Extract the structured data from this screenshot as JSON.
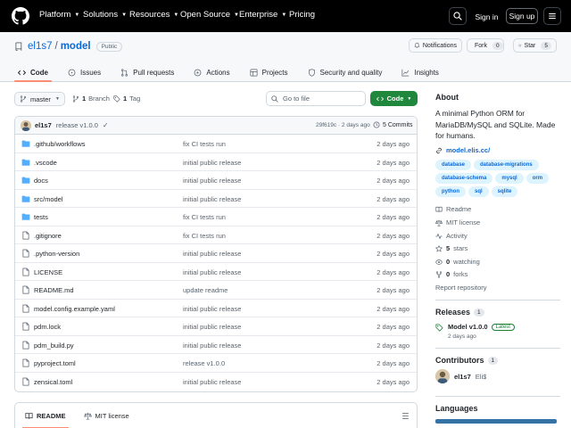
{
  "topbar": {
    "nav": [
      "Platform",
      "Solutions",
      "Resources",
      "Open Source",
      "Enterprise",
      "Pricing"
    ],
    "signin": "Sign in",
    "signup": "Sign up"
  },
  "repo": {
    "owner": "el1s7",
    "separator": "/",
    "name": "model",
    "visibility": "Public",
    "notifications_label": "Notifications",
    "fork_label": "Fork",
    "fork_count": "0",
    "star_label": "Star",
    "star_count": "5"
  },
  "tabs": [
    "Code",
    "Issues",
    "Pull requests",
    "Actions",
    "Projects",
    "Security and quality",
    "Insights"
  ],
  "branchbar": {
    "branch": "master",
    "branch_count": "1",
    "branch_label": "Branch",
    "tag_count": "1",
    "tag_label": "Tag",
    "goto_placeholder": "Go to file",
    "code_label": "Code"
  },
  "commit": {
    "author": "el1s7",
    "message": "release v1.0.0",
    "check": "✓",
    "hash_time": "29f619c · 2 days ago",
    "commits_label": "5 Commits"
  },
  "files": [
    {
      "type": "folder",
      "name": ".github/workflows",
      "message": "fix CI tests run",
      "date": "2 days ago"
    },
    {
      "type": "folder",
      "name": ".vscode",
      "message": "initial public release",
      "date": "2 days ago"
    },
    {
      "type": "folder",
      "name": "docs",
      "message": "initial public release",
      "date": "2 days ago"
    },
    {
      "type": "folder",
      "name": "src/model",
      "message": "initial public release",
      "date": "2 days ago"
    },
    {
      "type": "folder",
      "name": "tests",
      "message": "fix CI tests run",
      "date": "2 days ago"
    },
    {
      "type": "file",
      "name": ".gitignore",
      "message": "fix CI tests run",
      "date": "2 days ago"
    },
    {
      "type": "file",
      "name": ".python-version",
      "message": "initial public release",
      "date": "2 days ago"
    },
    {
      "type": "file",
      "name": "LICENSE",
      "message": "initial public release",
      "date": "2 days ago"
    },
    {
      "type": "file",
      "name": "README.md",
      "message": "update readme",
      "date": "2 days ago"
    },
    {
      "type": "file",
      "name": "model.config.example.yaml",
      "message": "initial public release",
      "date": "2 days ago"
    },
    {
      "type": "file",
      "name": "pdm.lock",
      "message": "initial public release",
      "date": "2 days ago"
    },
    {
      "type": "file",
      "name": "pdm_build.py",
      "message": "initial public release",
      "date": "2 days ago"
    },
    {
      "type": "file",
      "name": "pyproject.toml",
      "message": "release v1.0.0",
      "date": "2 days ago"
    },
    {
      "type": "file",
      "name": "zensical.toml",
      "message": "initial public release",
      "date": "2 days ago"
    }
  ],
  "readme_tabs": [
    "README",
    "MIT license"
  ],
  "about": {
    "heading": "About",
    "description": "A minimal Python ORM for MariaDB/MySQL and SQLite. Made for humans.",
    "link": "model.elis.cc/",
    "topics": [
      "database",
      "database-migrations",
      "database-schema",
      "mysql",
      "orm",
      "python",
      "sql",
      "sqlite"
    ],
    "readme": "Readme",
    "license": "MIT license",
    "activity": "Activity",
    "stars_count": "5",
    "stars_label": "stars",
    "watching_count": "0",
    "watching_label": "watching",
    "forks_count": "0",
    "forks_label": "forks",
    "report": "Report repository"
  },
  "releases": {
    "heading": "Releases",
    "count": "1",
    "name": "Model v1.0.0",
    "latest": "Latest",
    "date": "2 days ago"
  },
  "contributors": {
    "heading": "Contributors",
    "count": "1",
    "login": "el1s7",
    "name": "Eli$"
  },
  "languages": {
    "heading": "Languages",
    "bar_color": "#3572A5"
  },
  "colors": {
    "accent": "#0969da",
    "green": "#1f883d",
    "tab_underline": "#fd8c73",
    "topbar": "#000000"
  }
}
